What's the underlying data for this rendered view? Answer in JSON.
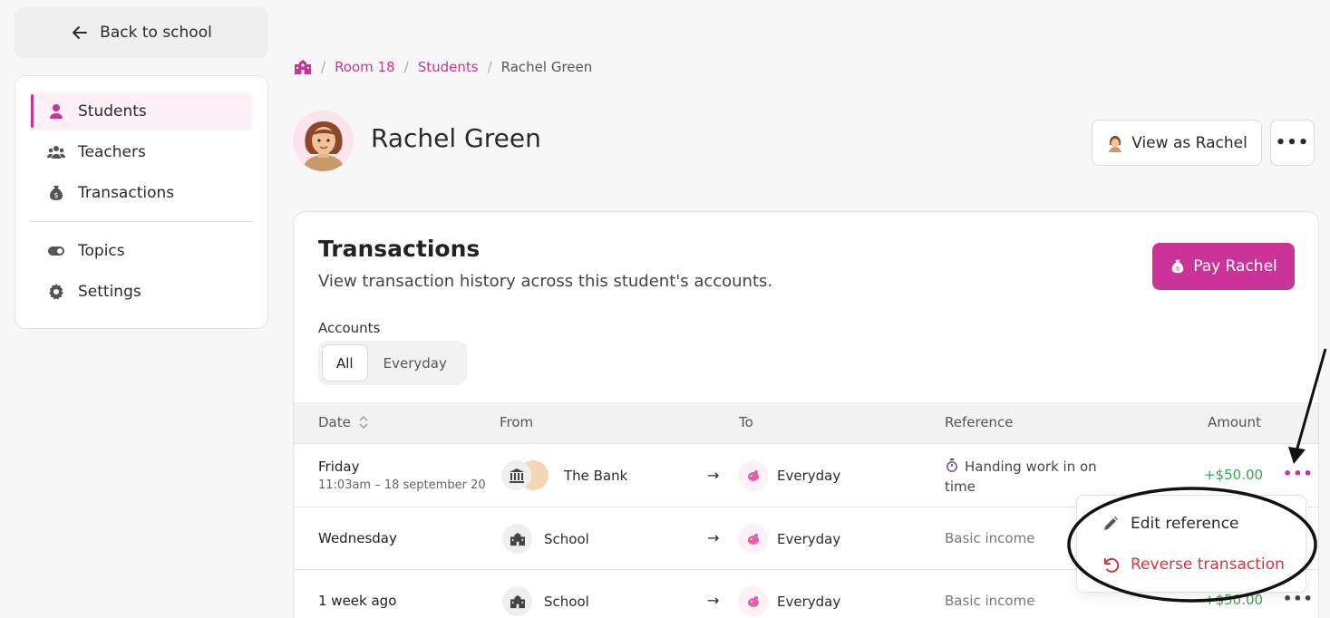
{
  "back_button": {
    "label": "Back to school"
  },
  "sidebar": {
    "items": [
      {
        "label": "Students",
        "icon": "person-icon",
        "active": true
      },
      {
        "label": "Teachers",
        "icon": "group-icon"
      },
      {
        "label": "Transactions",
        "icon": "money-bag-icon"
      },
      {
        "label": "Topics",
        "icon": "toggle-icon"
      },
      {
        "label": "Settings",
        "icon": "gear-icon"
      }
    ]
  },
  "breadcrumb": {
    "items": [
      "Room 18",
      "Students"
    ],
    "current": "Rachel Green"
  },
  "student": {
    "name": "Rachel Green"
  },
  "header_actions": {
    "view_as_label": "View as Rachel",
    "more_label": "•••"
  },
  "transactions": {
    "title": "Transactions",
    "subtitle": "View transaction history across this student's accounts.",
    "pay_label": "Pay Rachel",
    "accounts_label": "Accounts",
    "account_tabs": [
      "All",
      "Everyday"
    ],
    "selected_tab": "All",
    "columns": {
      "date": "Date",
      "from": "From",
      "to": "To",
      "reference": "Reference",
      "amount": "Amount"
    },
    "rows": [
      {
        "day": "Friday",
        "time": "11:03am – 18 september 20",
        "from": "The Bank",
        "to": "Everyday",
        "reference": "Handing work in on time",
        "amount": "+$50.00",
        "arrow": "→",
        "more": "•••"
      },
      {
        "day": "Wednesday",
        "time": "",
        "from": "School",
        "to": "Everyday",
        "reference": "Basic income",
        "amount": "",
        "arrow": "→",
        "more": ""
      },
      {
        "day": "1 week ago",
        "time": "",
        "from": "School",
        "to": "Everyday",
        "reference": "Basic income",
        "amount": "+$50.00",
        "arrow": "→",
        "more": "•••"
      }
    ]
  },
  "row_menu": {
    "items": [
      {
        "label": "Edit reference",
        "icon": "pencil-icon"
      },
      {
        "label": "Reverse transaction",
        "icon": "undo-icon",
        "danger": true
      }
    ]
  },
  "colors": {
    "accent": "#cc3399",
    "positive": "#2fa84f",
    "danger": "#d8343f"
  }
}
